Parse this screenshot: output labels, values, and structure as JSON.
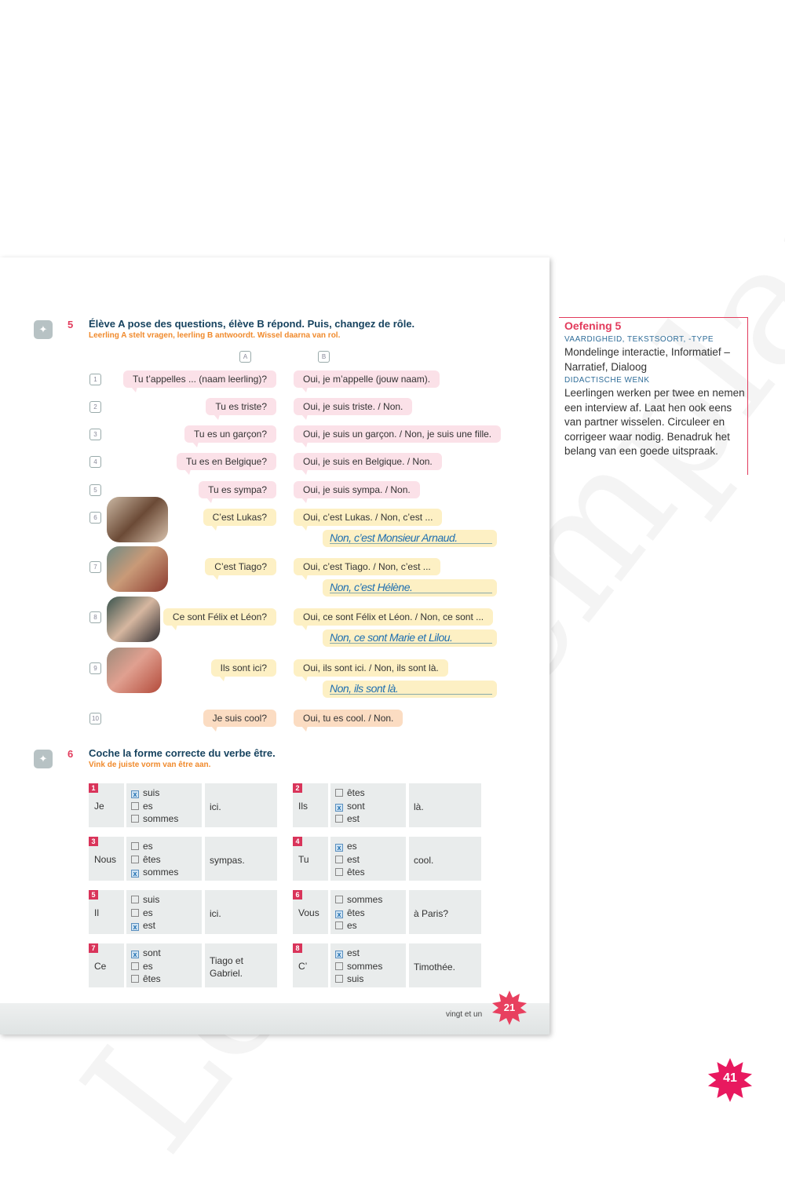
{
  "watermark": "Leesexemplaar",
  "exercise5": {
    "number": "5",
    "title": "Élève A pose des questions, élève B répond. Puis, changez de rôle.",
    "subtitle": "Leerling A stelt vragen, leerling B antwoordt. Wissel daarna van rol.",
    "col_a": "A",
    "col_b": "B",
    "rows": [
      {
        "n": "1",
        "q": "Tu t’appelles ... (naam leerling)?",
        "a": "Oui, je m’appelle (jouw naam).",
        "color": "pink"
      },
      {
        "n": "2",
        "q": "Tu es triste?",
        "a": "Oui, je suis triste. / Non.",
        "color": "pink"
      },
      {
        "n": "3",
        "q": "Tu es un garçon?",
        "a": "Oui, je suis un garçon. / Non, je suis une fille.",
        "color": "pink"
      },
      {
        "n": "4",
        "q": "Tu es en Belgique?",
        "a": "Oui, je suis en Belgique. / Non.",
        "color": "pink"
      },
      {
        "n": "5",
        "q": "Tu es sympa?",
        "a": "Oui, je suis sympa. / Non.",
        "color": "pink"
      },
      {
        "n": "6",
        "q": "C’est Lukas?",
        "a": "Oui, c’est Lukas. / Non, c’est ...",
        "answer": "Non, c’est Monsieur Arnaud.",
        "color": "yellow",
        "photo": "young man smiling"
      },
      {
        "n": "7",
        "q": "C’est Tiago?",
        "a": "Oui, c’est Tiago. / Non, c’est ...",
        "answer": "Non, c’est Hélène.",
        "color": "yellow",
        "photo": "girl with long hair"
      },
      {
        "n": "8",
        "q": "Ce sont Félix et Léon?",
        "a": "Oui, ce sont Félix et Léon. / Non, ce sont ...",
        "answer": "Non, ce sont Marie et Lilou.",
        "color": "yellow",
        "photo": "two girls"
      },
      {
        "n": "9",
        "q": "Ils sont ici?",
        "a": "Oui, ils sont ici. / Non, ils sont là.",
        "answer": "Non, ils sont là.",
        "color": "yellow",
        "photo": "two boys"
      },
      {
        "n": "10",
        "q": "Je suis cool?",
        "a": "Oui, tu es cool. / Non.",
        "color": "orange"
      }
    ]
  },
  "exercise6": {
    "number": "6",
    "title": "Coche la forme correcte du verbe être.",
    "subtitle": "Vink de juiste vorm van être aan.",
    "items": [
      {
        "n": "1",
        "subject": "Je",
        "options": [
          {
            "t": "suis",
            "checked": true
          },
          {
            "t": "es",
            "checked": false
          },
          {
            "t": "sommes",
            "checked": false
          }
        ],
        "rest": "ici."
      },
      {
        "n": "2",
        "subject": "Ils",
        "options": [
          {
            "t": "êtes",
            "checked": false
          },
          {
            "t": "sont",
            "checked": true
          },
          {
            "t": "est",
            "checked": false
          }
        ],
        "rest": "là."
      },
      {
        "n": "3",
        "subject": "Nous",
        "options": [
          {
            "t": "es",
            "checked": false
          },
          {
            "t": "êtes",
            "checked": false
          },
          {
            "t": "sommes",
            "checked": true
          }
        ],
        "rest": "sympas."
      },
      {
        "n": "4",
        "subject": "Tu",
        "options": [
          {
            "t": "es",
            "checked": true
          },
          {
            "t": "est",
            "checked": false
          },
          {
            "t": "êtes",
            "checked": false
          }
        ],
        "rest": "cool."
      },
      {
        "n": "5",
        "subject": "Il",
        "options": [
          {
            "t": "suis",
            "checked": false
          },
          {
            "t": "es",
            "checked": false
          },
          {
            "t": "est",
            "checked": true
          }
        ],
        "rest": "ici."
      },
      {
        "n": "6",
        "subject": "Vous",
        "options": [
          {
            "t": "sommes",
            "checked": false
          },
          {
            "t": "êtes",
            "checked": true
          },
          {
            "t": "es",
            "checked": false
          }
        ],
        "rest": "à Paris?"
      },
      {
        "n": "7",
        "subject": "Ce",
        "options": [
          {
            "t": "sont",
            "checked": true
          },
          {
            "t": "es",
            "checked": false
          },
          {
            "t": "êtes",
            "checked": false
          }
        ],
        "rest": "Tiago et Gabriel."
      },
      {
        "n": "8",
        "subject": "C’",
        "options": [
          {
            "t": "est",
            "checked": true
          },
          {
            "t": "sommes",
            "checked": false
          },
          {
            "t": "suis",
            "checked": false
          }
        ],
        "rest": "Timothée."
      }
    ]
  },
  "footer": {
    "page_words": "vingt et un",
    "page_number": "21"
  },
  "sidebar": {
    "title": "Oefening 5",
    "cap1": "VAARDIGHEID, TEKSTSOORT, -TYPE",
    "text1": "Mondelinge interactie, Informatief – Narratief, Dialoog",
    "cap2": "DIDACTISCHE WENK",
    "text2": "Leerlingen werken per twee en nemen een interview af. Laat hen ook eens van partner wisselen. Circuleer en corrigeer waar nodig. Benadruk het belang van een goede uitspraak."
  },
  "outer_page_number": "41",
  "colors": {
    "accent": "#e23b5c",
    "title": "#17435f",
    "subtitle": "#f08a2c",
    "answer": "#1f6fb0",
    "pink": "#fbe1e8",
    "yellow": "#fdf0c4",
    "orange": "#fbdcc2"
  }
}
